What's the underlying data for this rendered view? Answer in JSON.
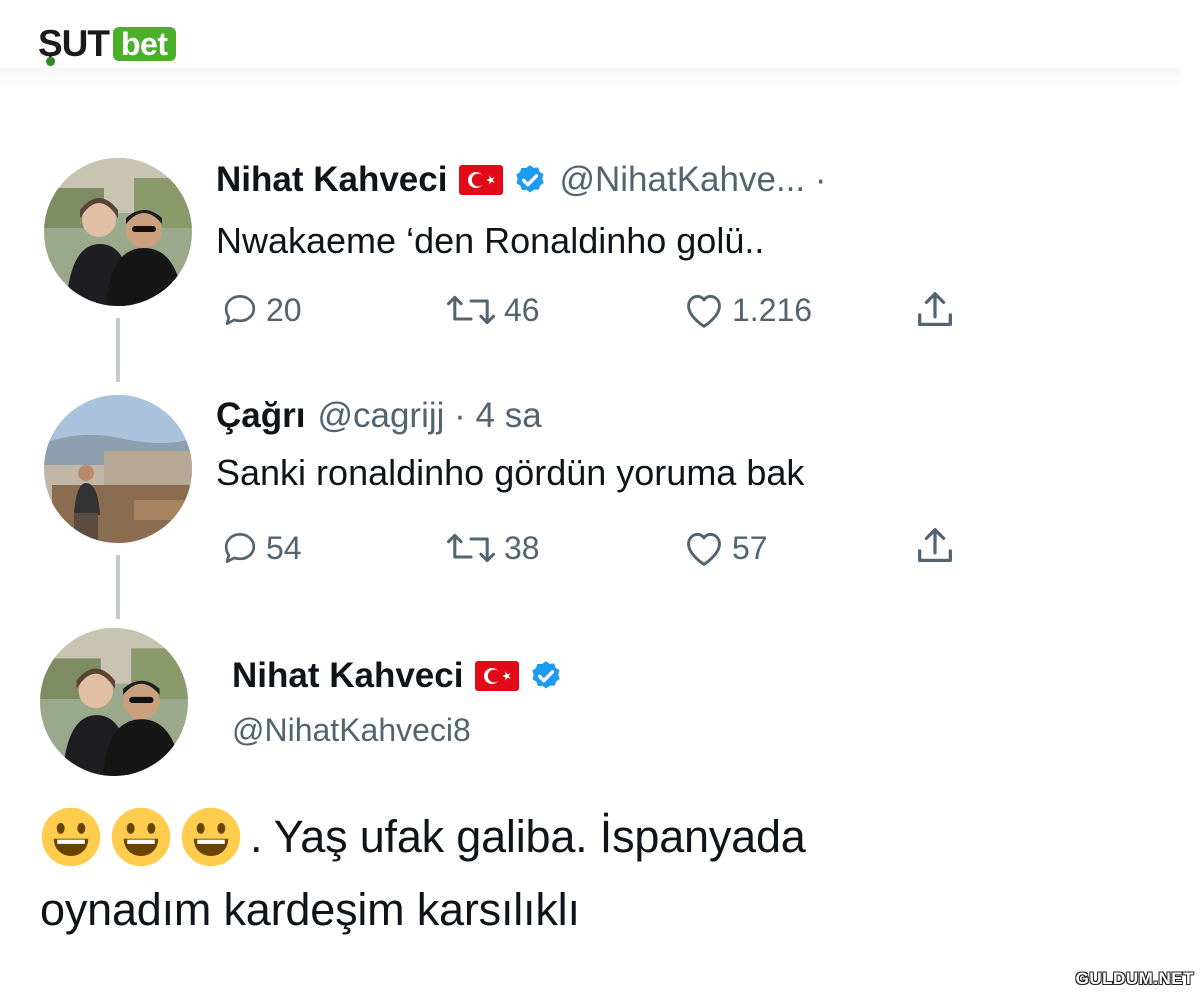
{
  "brand": {
    "part1": "ŞUT",
    "part2": "bet",
    "accent": "#4caf2a"
  },
  "tweet1": {
    "name": "Nihat Kahveci",
    "handle_meta": "@NihatKahve... ·",
    "text": "Nwakaeme ‘den Ronaldinho golü..",
    "replies": "20",
    "retweets": "46",
    "likes": "1.216"
  },
  "tweet2": {
    "name": "Çağrı",
    "handle_meta": "@cagrijj · 4 sa",
    "text": "Sanki ronaldinho gördün yoruma bak",
    "replies": "54",
    "retweets": "38",
    "likes": "57"
  },
  "tweet3": {
    "name": "Nihat Kahveci",
    "handle": "@NihatKahveci8",
    "text_line1": ". Yaş ufak galiba. İspanyada",
    "text_line2": "oynadım kardeşim karsılıklı"
  },
  "icons": {
    "reply": "reply-icon",
    "retweet": "retweet-icon",
    "like": "heart-icon",
    "share": "share-icon",
    "verified": "verified-badge-icon",
    "flag": "turkey-flag-icon",
    "emoji": "grinning-face-emoji"
  },
  "colors": {
    "verified": "#1d9bf0",
    "flag": "#e30a17",
    "muted": "#536471"
  },
  "watermark": "GULDUM.NET"
}
